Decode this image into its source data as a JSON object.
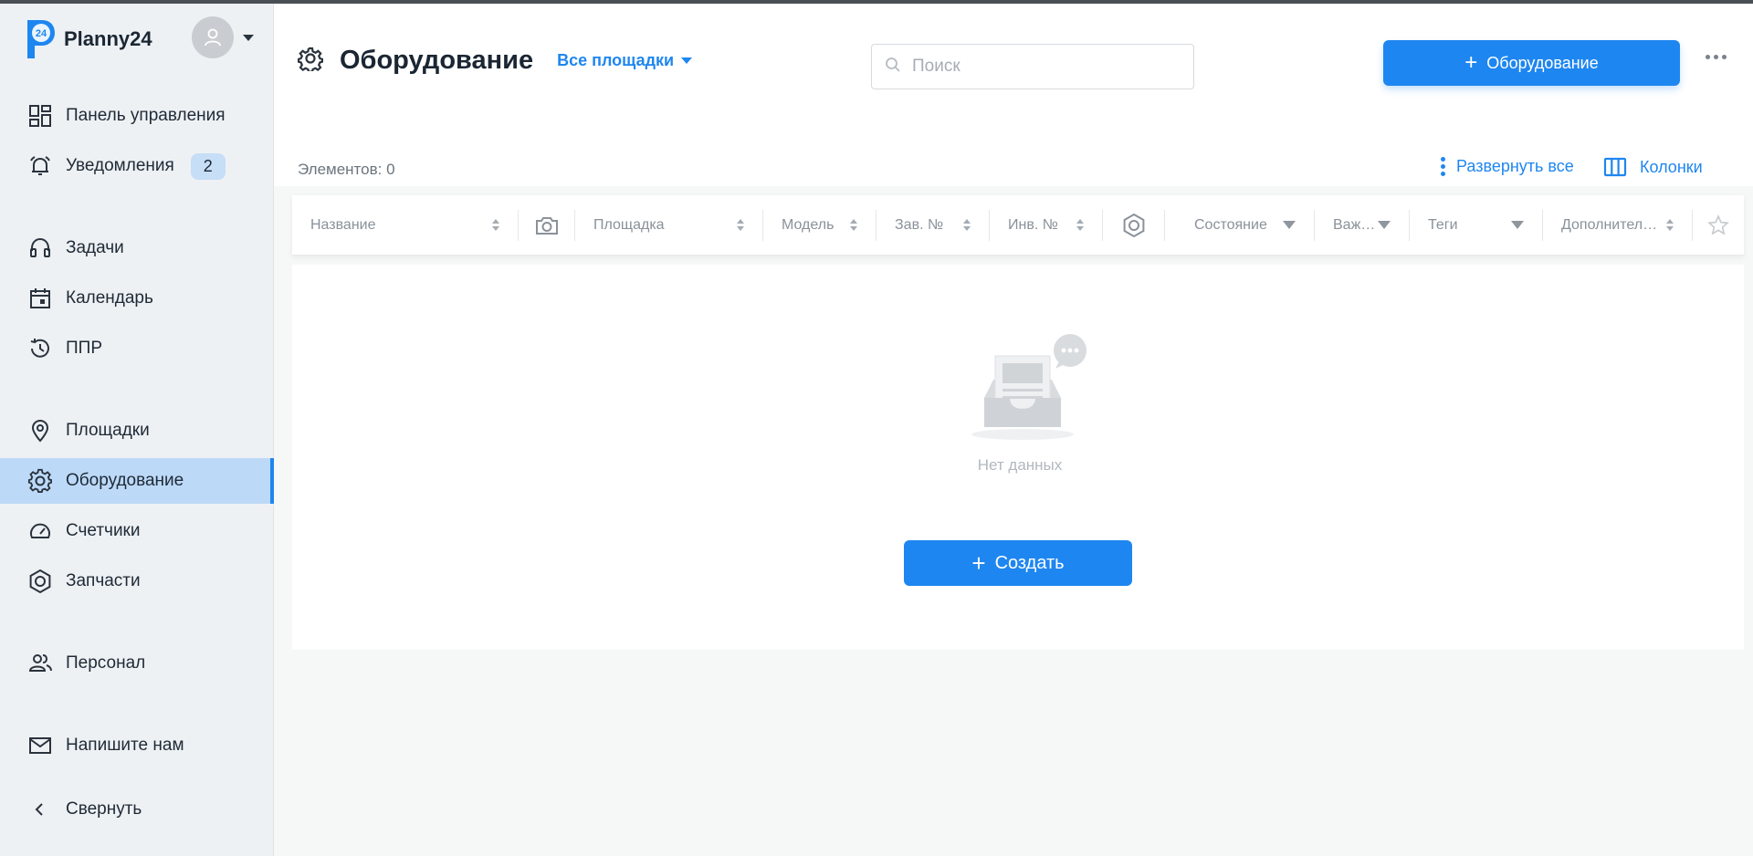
{
  "app": {
    "name": "Planny24",
    "logo_text": "24"
  },
  "sidebar": {
    "items": [
      {
        "key": "dashboard",
        "label": "Панель управления",
        "icon": "dashboard-icon"
      },
      {
        "key": "notifications",
        "label": "Уведомления",
        "icon": "bell-icon",
        "badge": "2"
      },
      {
        "key": "tasks",
        "label": "Задачи",
        "icon": "headset-icon"
      },
      {
        "key": "calendar",
        "label": "Календарь",
        "icon": "calendar-icon"
      },
      {
        "key": "ppr",
        "label": "ППР",
        "icon": "history-icon"
      },
      {
        "key": "sites",
        "label": "Площадки",
        "icon": "location-pin-icon"
      },
      {
        "key": "equipment",
        "label": "Оборудование",
        "icon": "gear-icon",
        "active": true
      },
      {
        "key": "meters",
        "label": "Счетчики",
        "icon": "gauge-icon"
      },
      {
        "key": "parts",
        "label": "Запчасти",
        "icon": "hex-nut-icon"
      },
      {
        "key": "staff",
        "label": "Персонал",
        "icon": "people-icon"
      },
      {
        "key": "contact",
        "label": "Напишите нам",
        "icon": "mail-icon"
      },
      {
        "key": "collapse",
        "label": "Свернуть",
        "icon": "chevron-left-icon"
      }
    ]
  },
  "header": {
    "title": "Оборудование",
    "sites_filter": "Все площадки",
    "search_placeholder": "Поиск",
    "add_button": "Оборудование",
    "elements_count": "Элементов: 0",
    "expand_all": "Развернуть все",
    "columns": "Колонки"
  },
  "table": {
    "columns": [
      {
        "key": "name",
        "label": "Название",
        "control": "sort"
      },
      {
        "key": "photo",
        "label": "",
        "icon": "camera-icon"
      },
      {
        "key": "site",
        "label": "Площадка",
        "control": "sort"
      },
      {
        "key": "model",
        "label": "Модель",
        "control": "sort"
      },
      {
        "key": "serial",
        "label": "Зав. №",
        "control": "sort"
      },
      {
        "key": "inventory",
        "label": "Инв. №",
        "control": "sort"
      },
      {
        "key": "parts",
        "label": "",
        "icon": "hex-nut-icon"
      },
      {
        "key": "state",
        "label": "Состояние",
        "control": "filter"
      },
      {
        "key": "importance",
        "label": "Важ…",
        "control": "filter"
      },
      {
        "key": "tags",
        "label": "Теги",
        "control": "filter"
      },
      {
        "key": "extra",
        "label": "Дополнител…",
        "control": "sort"
      },
      {
        "key": "favorite",
        "label": "",
        "icon": "star-icon"
      }
    ],
    "empty_text": "Нет данных",
    "create_button": "Создать"
  },
  "colors": {
    "accent": "#1e86f0",
    "active_bg": "#bcd9f8",
    "sidebar_bg": "#eef1f4"
  }
}
